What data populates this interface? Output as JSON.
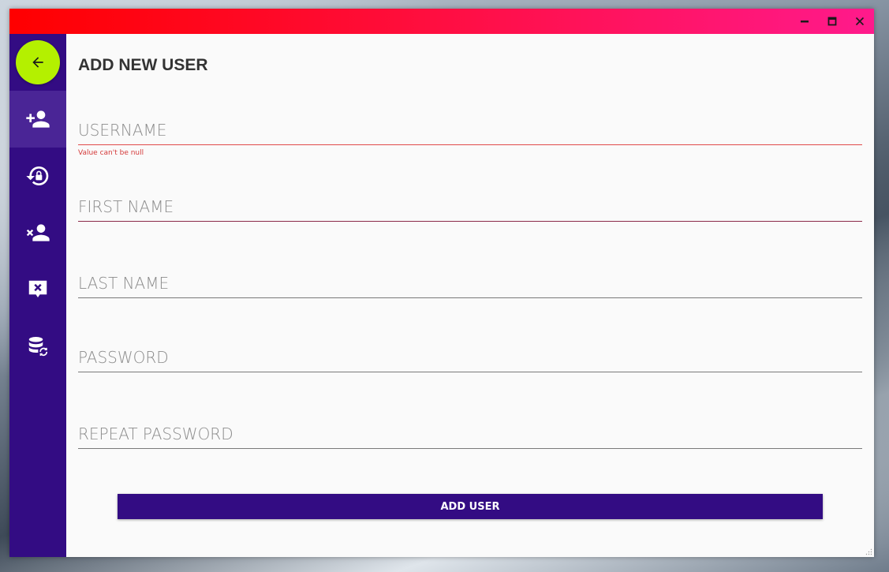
{
  "window": {
    "titlebar_gradient": [
      "#ff0000",
      "#ff1a8c"
    ],
    "controls": [
      "minimize-icon",
      "maximize-icon",
      "close-icon"
    ]
  },
  "sidebar": {
    "background": "#330c83",
    "back_icon": "arrow-left-icon",
    "items": [
      {
        "icon": "add-user-icon",
        "active": true
      },
      {
        "icon": "reset-lock-icon",
        "active": false
      },
      {
        "icon": "remove-user-icon",
        "active": false
      },
      {
        "icon": "message-delete-icon",
        "active": false
      },
      {
        "icon": "database-sync-icon",
        "active": false
      }
    ]
  },
  "main": {
    "title": "ADD NEW USER",
    "fields": {
      "username": {
        "placeholder": "USERNAME",
        "value": "",
        "error": "Value can't be null"
      },
      "first_name": {
        "placeholder": "FIRST NAME",
        "value": ""
      },
      "last_name": {
        "placeholder": "LAST NAME",
        "value": ""
      },
      "password": {
        "placeholder": "PASSWORD",
        "value": ""
      },
      "repeat_password": {
        "placeholder": "REPEAT PASSWORD",
        "value": ""
      }
    },
    "submit_label": "ADD USER"
  },
  "colors": {
    "accent": "#b4f000",
    "primary": "#330c83",
    "error": "#d43a3a"
  }
}
